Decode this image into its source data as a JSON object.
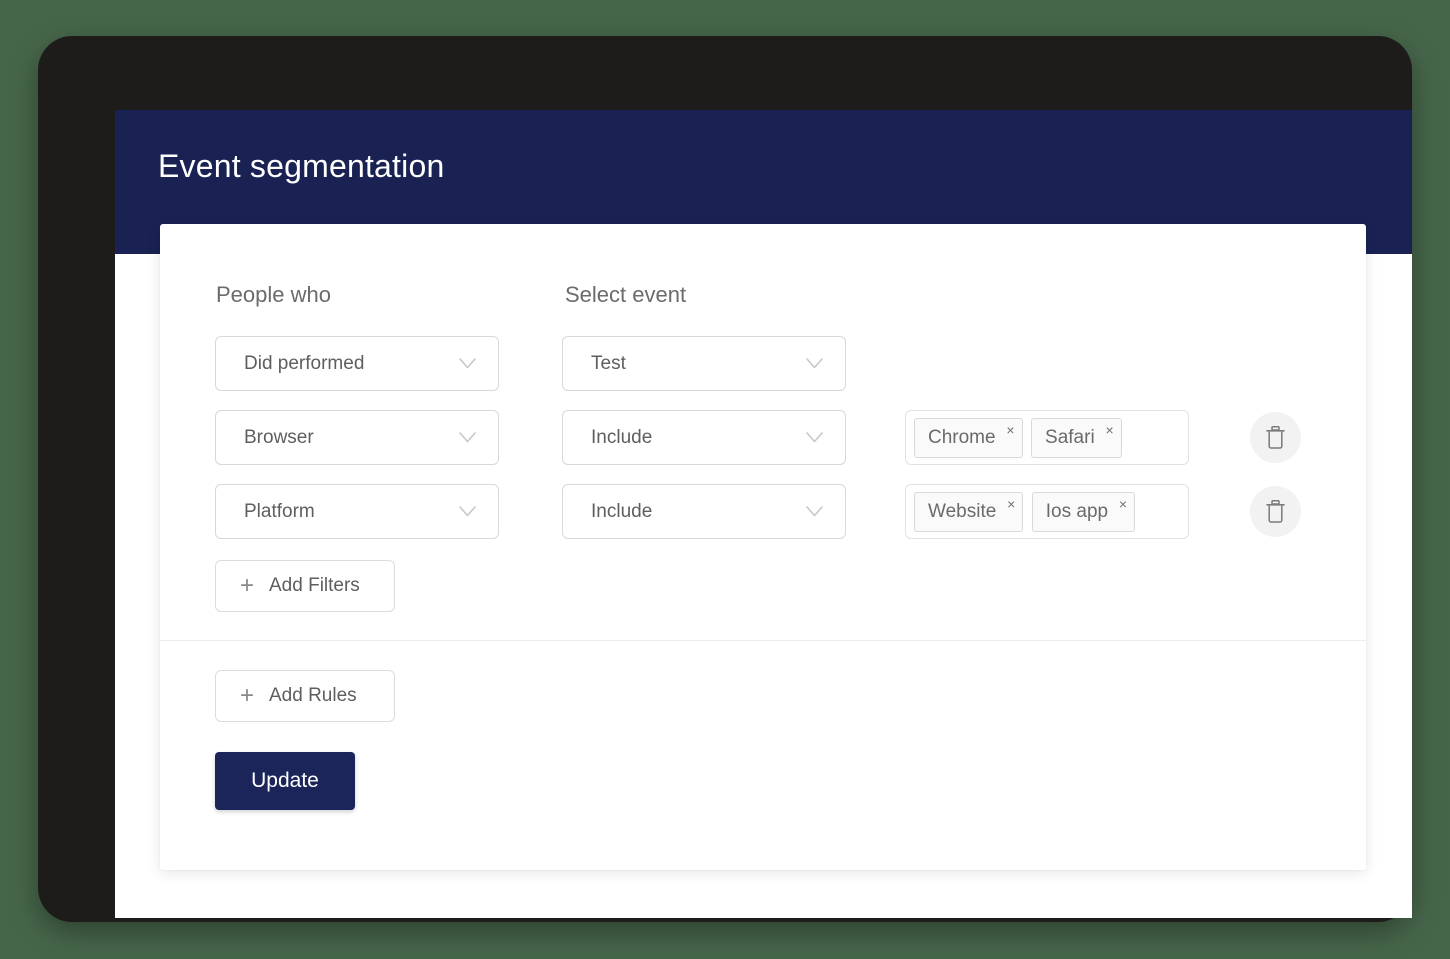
{
  "page": {
    "background_color": "#46664a",
    "device_bezel_color": "#1e1c1b"
  },
  "header": {
    "title": "Event segmentation",
    "background_color": "#192253",
    "text_color": "#ffffff"
  },
  "card": {
    "columns": {
      "people_who": "People who",
      "select_event": "Select event"
    },
    "rows": [
      {
        "attribute": {
          "value": "Did performed",
          "icon": "chevron-down-icon"
        },
        "condition": {
          "value": "Test",
          "icon": "chevron-down-icon"
        },
        "has_tags": false,
        "has_delete": false,
        "tags": []
      },
      {
        "attribute": {
          "value": "Browser",
          "icon": "chevron-down-icon"
        },
        "condition": {
          "value": "Include",
          "icon": "chevron-down-icon"
        },
        "has_tags": true,
        "has_delete": true,
        "tags": [
          {
            "label": "Chrome",
            "remove": "×"
          },
          {
            "label": "Safari",
            "remove": "×"
          }
        ],
        "delete_icon": "trash-icon"
      },
      {
        "attribute": {
          "value": "Platform",
          "icon": "chevron-down-icon"
        },
        "condition": {
          "value": "Include",
          "icon": "chevron-down-icon"
        },
        "has_tags": true,
        "has_delete": true,
        "tags": [
          {
            "label": "Website",
            "remove": "×"
          },
          {
            "label": "Ios app",
            "remove": "×"
          }
        ],
        "delete_icon": "trash-icon"
      }
    ],
    "add_filters": {
      "plus": "+",
      "label": "Add Filters"
    },
    "add_rules": {
      "plus": "+",
      "label": "Add Rules"
    },
    "update": {
      "label": "Update",
      "background_color": "#1c2559"
    }
  }
}
